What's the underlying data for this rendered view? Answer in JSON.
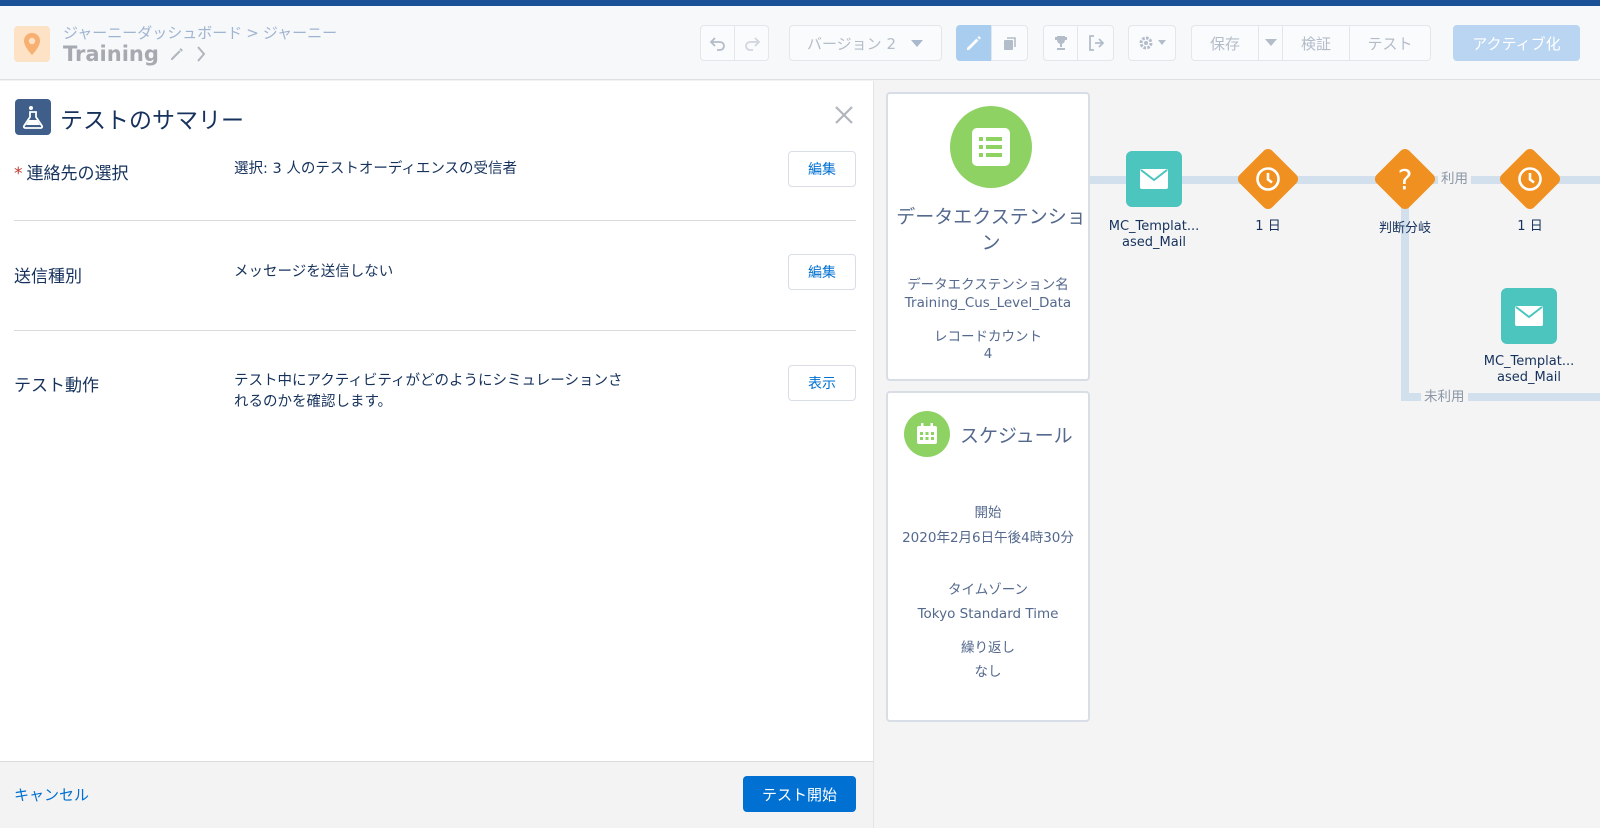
{
  "header": {
    "breadcrumb": [
      "ジャーニーダッシュボード",
      "ジャーニー"
    ],
    "breadcrumb_sep": ">",
    "journey_name": "Training",
    "version_label": "バージョン 2",
    "save_label": "保存",
    "validate_label": "検証",
    "test_label": "テスト",
    "activate_label": "アクティブ化"
  },
  "panel": {
    "title": "テストのサマリー",
    "rows": [
      {
        "required": "*",
        "label": "連絡先の選択",
        "value": "選択: 3 人のテストオーディエンスの受信者",
        "button": "編集"
      },
      {
        "label": "送信種別",
        "value": "メッセージを送信しない",
        "button": "編集"
      },
      {
        "label": "テスト動作",
        "value": "テスト中にアクティビティがどのようにシミュレーションされるのかを確認します。",
        "button": "表示"
      }
    ],
    "cancel_label": "キャンセル",
    "start_label": "テスト開始"
  },
  "canvas": {
    "data_extension": {
      "title": "データエクステンション",
      "name_label": "データエクステンション名",
      "name_value": "Training_Cus_Level_Data",
      "count_label": "レコードカウント",
      "count_value": "4"
    },
    "schedule": {
      "title": "スケジュール",
      "start_label": "開始",
      "start_value": "2020年2月6日午後4時30分",
      "tz_label": "タイムゾーン",
      "tz_value": "Tokyo Standard Time",
      "repeat_label": "繰り返し",
      "repeat_value": "なし"
    },
    "nodes": {
      "email1": "MC_Templat...\nased_Mail",
      "wait1": "1 日",
      "decision": "判断分岐",
      "wait2": "1 日",
      "email2": "MC_Templat...\nased_Mail"
    },
    "path_used": "利用",
    "path_unused": "未利用"
  },
  "colors": {
    "accent": "#0070d2",
    "mail_node": "#4bc5bd",
    "decision_node": "#f09020",
    "entry_green": "#8ed264",
    "top_band": "#1b5297"
  }
}
